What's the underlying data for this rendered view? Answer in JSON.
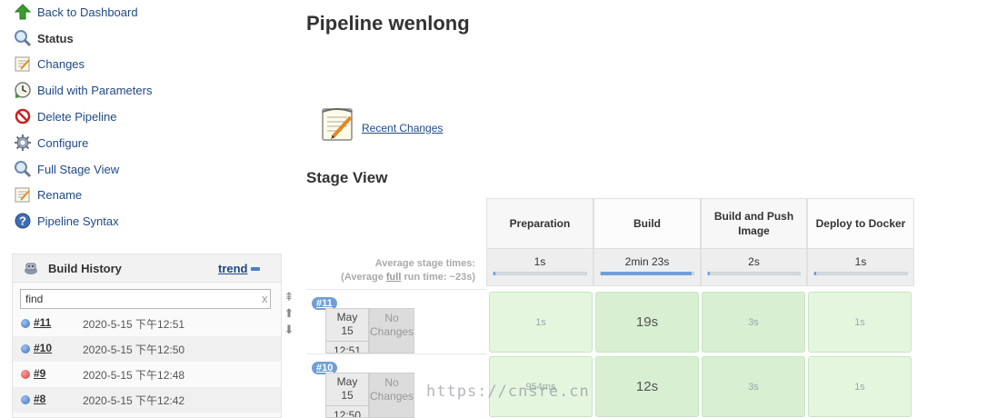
{
  "sidebar": {
    "items": [
      {
        "label": "Back to Dashboard",
        "icon": "up-arrow-icon"
      },
      {
        "label": "Status",
        "icon": "magnifier-icon"
      },
      {
        "label": "Changes",
        "icon": "notepad-icon"
      },
      {
        "label": "Build with Parameters",
        "icon": "clock-icon"
      },
      {
        "label": "Delete Pipeline",
        "icon": "no-entry-icon"
      },
      {
        "label": "Configure",
        "icon": "gear-icon"
      },
      {
        "label": "Full Stage View",
        "icon": "magnifier-icon"
      },
      {
        "label": "Rename",
        "icon": "notepad-icon"
      },
      {
        "label": "Pipeline Syntax",
        "icon": "help-icon"
      }
    ]
  },
  "build_history": {
    "title": "Build History",
    "trend_label": "trend",
    "find_value": "find",
    "clear_glyph": "x",
    "arrows": [
      "⇞",
      "⬆",
      "⬇"
    ],
    "builds": [
      {
        "number": "#11",
        "date": "2020-5-15 下午12:51",
        "status": "blue"
      },
      {
        "number": "#10",
        "date": "2020-5-15 下午12:50",
        "status": "blue"
      },
      {
        "number": "#9",
        "date": "2020-5-15 下午12:48",
        "status": "red"
      },
      {
        "number": "#8",
        "date": "2020-5-15 下午12:42",
        "status": "blue"
      }
    ]
  },
  "main": {
    "title": "Pipeline wenlong",
    "recent_changes": "Recent Changes",
    "stage_view_title": "Stage View",
    "average_label_1": "Average stage times:",
    "average_label_2a": "(Average ",
    "average_label_2b": "full",
    "average_label_2c": " run time: ~23s)"
  },
  "stages": [
    {
      "name": "Preparation",
      "avg": "1s",
      "avg_fraction": 0.01
    },
    {
      "name": "Build",
      "avg": "2min 23s",
      "avg_fraction": 0.98
    },
    {
      "name": "Build and Push Image",
      "avg": "2s",
      "avg_fraction": 0.02
    },
    {
      "name": "Deploy to Docker",
      "avg": "1s",
      "avg_fraction": 0.01
    }
  ],
  "runs": [
    {
      "number": "#11",
      "month": "May",
      "day": "15",
      "time": "12:51",
      "changes": "No Changes",
      "times": [
        "1s",
        "19s",
        "3s",
        "1s"
      ]
    },
    {
      "number": "#10",
      "month": "May",
      "day": "15",
      "time": "12:50",
      "changes": "No Changes",
      "times": [
        "954ms",
        "12s",
        "3s",
        "1s"
      ]
    }
  ],
  "watermark": "https://cnsre.cn",
  "colors": {
    "link": "#204a87",
    "success_cell": "#e4f7de",
    "progress": "#6f9fd8",
    "status_blue": "#3b6fc4",
    "status_red": "#d83a3a"
  }
}
